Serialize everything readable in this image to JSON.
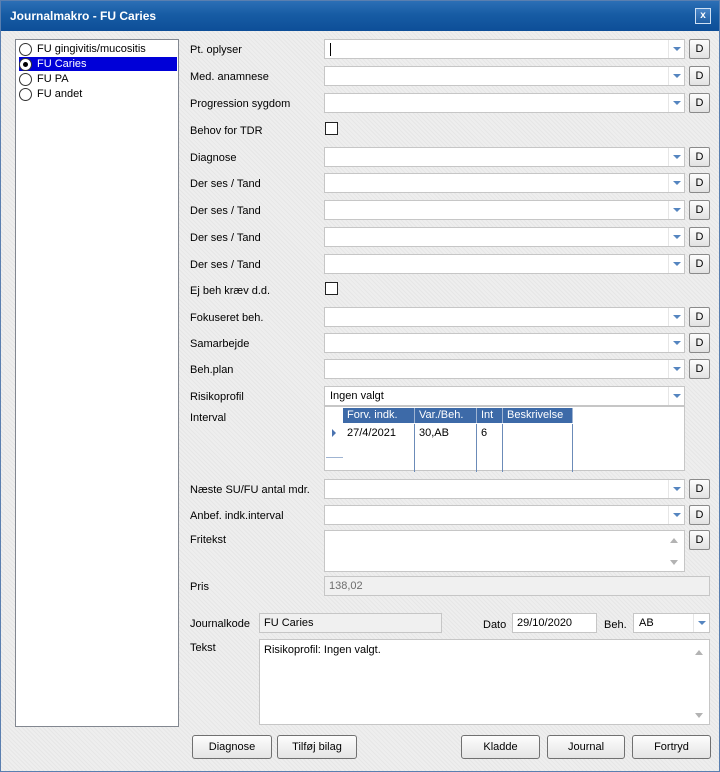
{
  "window": {
    "title": "Journalmakro - FU Caries",
    "close_label": "x"
  },
  "options": [
    {
      "label": "FU gingivitis/mucositis",
      "selected": false
    },
    {
      "label": "FU Caries",
      "selected": true
    },
    {
      "label": "FU PA",
      "selected": false
    },
    {
      "label": "FU andet",
      "selected": false
    }
  ],
  "fields": {
    "pt_oplyser": {
      "label": "Pt. oplyser",
      "value": ""
    },
    "med_anamnese": {
      "label": "Med. anamnese",
      "value": ""
    },
    "progression": {
      "label": "Progression sygdom",
      "value": ""
    },
    "behov_tdr": {
      "label": "Behov for TDR",
      "checked": false
    },
    "diagnose": {
      "label": "Diagnose",
      "value": ""
    },
    "der_ses_1": {
      "label": "Der ses / Tand",
      "value": ""
    },
    "der_ses_2": {
      "label": "Der ses / Tand",
      "value": ""
    },
    "der_ses_3": {
      "label": "Der ses / Tand",
      "value": ""
    },
    "der_ses_4": {
      "label": "Der ses / Tand",
      "value": ""
    },
    "ej_beh": {
      "label": "Ej beh kræv d.d.",
      "checked": false
    },
    "fokuseret": {
      "label": "Fokuseret beh.",
      "value": ""
    },
    "samarbejde": {
      "label": "Samarbejde",
      "value": ""
    },
    "beh_plan": {
      "label": "Beh.plan",
      "value": ""
    },
    "risikoprofil": {
      "label": "Risikoprofil",
      "value": "Ingen valgt"
    },
    "interval": {
      "label": "Interval"
    },
    "naeste_su": {
      "label": "Næste SU/FU antal mdr.",
      "value": ""
    },
    "anbef": {
      "label": "Anbef. indk.interval",
      "value": ""
    },
    "fritekst": {
      "label": "Fritekst",
      "value": ""
    },
    "pris": {
      "label": "Pris",
      "value": "138,02"
    },
    "journalkode": {
      "label": "Journalkode",
      "value": "FU Caries"
    },
    "dato": {
      "label": "Dato",
      "value": "29/10/2020"
    },
    "beh": {
      "label": "Beh.",
      "value": "AB"
    },
    "tekst": {
      "label": "Tekst",
      "value": "Risikoprofil: Ingen valgt."
    }
  },
  "d_button_label": "D",
  "interval_grid": {
    "columns": [
      "Forv. indk.",
      "Var./Beh.",
      "Int",
      "Beskrivelse"
    ],
    "rows": [
      [
        "27/4/2021",
        "30,AB",
        "6",
        ""
      ]
    ]
  },
  "buttons": {
    "diagnose": "Diagnose",
    "tilfoj_bilag": "Tilføj bilag",
    "kladde": "Kladde",
    "journal": "Journal",
    "fortryd": "Fortryd"
  }
}
